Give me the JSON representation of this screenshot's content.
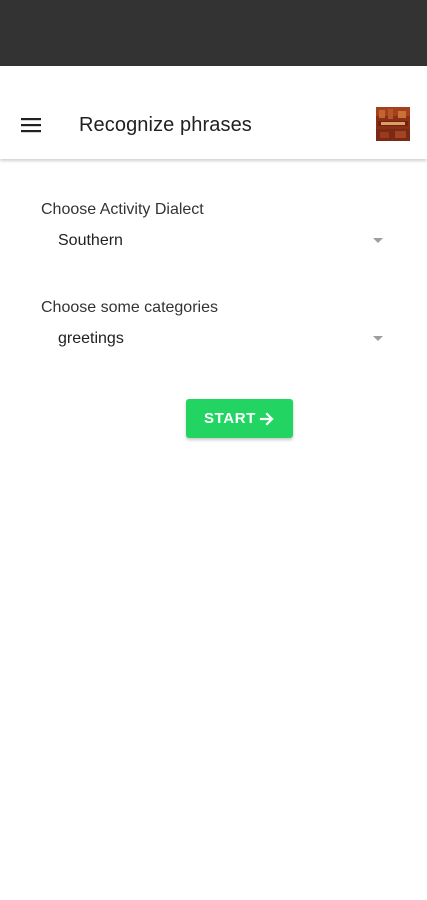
{
  "colors": {
    "status_bar": "#333333",
    "app_bar": "#ffffff",
    "accent_button": "#22d563",
    "text_primary": "#212121",
    "dropdown_arrow": "#9e9e9e"
  },
  "app_bar": {
    "title": "Recognize phrases",
    "menu_icon": "hamburger-menu-icon",
    "avatar_icon": "profile-avatar-image"
  },
  "form": {
    "dialect": {
      "label": "Choose Activity Dialect",
      "selected": "Southern"
    },
    "categories": {
      "label": "Choose some categories",
      "selected": "greetings"
    },
    "start_button": {
      "label": "START",
      "icon": "arrow-right-icon"
    }
  }
}
